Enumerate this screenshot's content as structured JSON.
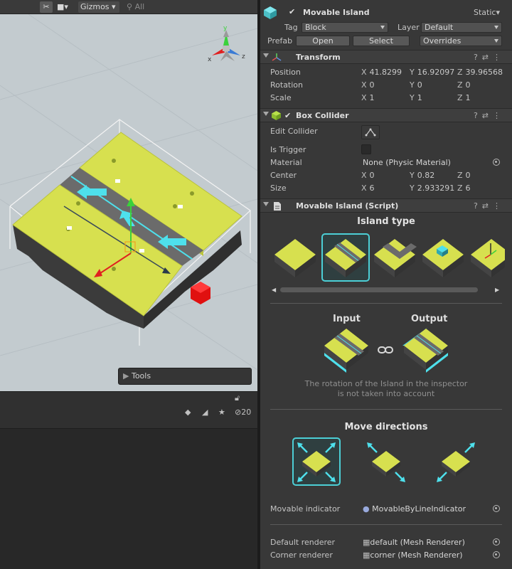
{
  "scene": {
    "toolbar": {
      "gizmos_label": "Gizmos",
      "search_label": "All"
    },
    "tools_panel_label": "Tools",
    "hidden_count": "20",
    "colors": {
      "grass": "#d7e04f",
      "dirt": "#3a3a3a",
      "road": "#6b6b6b",
      "cyan": "#4ee0ec",
      "bound": "#f2f2f2",
      "red": "#e01010"
    }
  },
  "inspector": {
    "object_name": "Movable Island",
    "static_label": "Static",
    "tag_label": "Tag",
    "tag_value": "Block",
    "layer_label": "Layer",
    "layer_value": "Default",
    "prefab_label": "Prefab",
    "open_label": "Open",
    "select_label": "Select",
    "overrides_label": "Overrides",
    "transform": {
      "title": "Transform",
      "position_label": "Position",
      "position": {
        "x": "41.8299",
        "y": "16.92097",
        "z": "39.96568"
      },
      "rotation_label": "Rotation",
      "rotation": {
        "x": "0",
        "y": "0",
        "z": "0"
      },
      "scale_label": "Scale",
      "scale": {
        "x": "1",
        "y": "1",
        "z": "1"
      }
    },
    "box_collider": {
      "title": "Box Collider",
      "edit_label": "Edit Collider",
      "trigger_label": "Is Trigger",
      "material_label": "Material",
      "material_value": "None (Physic Material)",
      "center_label": "Center",
      "center": {
        "x": "0",
        "y": "0.82",
        "z": "0"
      },
      "size_label": "Size",
      "size": {
        "x": "6",
        "y": "2.933291",
        "z": "6"
      }
    },
    "script": {
      "title": "Movable Island (Script)",
      "island_type_title": "Island type",
      "input_label": "Input",
      "output_label": "Output",
      "note_line1": "The rotation of the Island in the inspector",
      "note_line2": "is not taken into account",
      "move_directions_title": "Move directions",
      "movable_indicator_label": "Movable indicator",
      "movable_indicator_value": "MovableByLineIndicator",
      "default_renderer_label": "Default renderer",
      "default_renderer_value": "default (Mesh Renderer)",
      "corner_renderer_label": "Corner renderer",
      "corner_renderer_value": "corner (Mesh Renderer)"
    },
    "axis_x": "X",
    "axis_y": "Y",
    "axis_z": "Z",
    "colors": {
      "accent": "#4ccfd6",
      "checkbox": "#d8d8d8"
    }
  }
}
